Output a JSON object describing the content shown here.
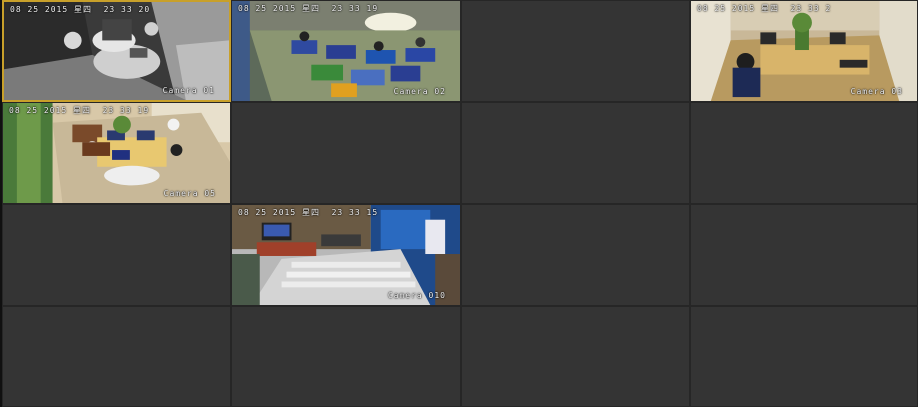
{
  "grid": {
    "columns": 4,
    "rows": 4
  },
  "selected_color": "#c8a02a",
  "cells": [
    {
      "index": 0,
      "has_feed": true,
      "feed": "ir-night-office",
      "timestamp": "08 25 2015 星四  23 33 20",
      "camera": "Camera 01",
      "selected": true
    },
    {
      "index": 1,
      "has_feed": true,
      "feed": "cafe-room-wide",
      "timestamp": "08 25 2015 星四  23 33 19",
      "camera": "Camera 02"
    },
    {
      "index": 2,
      "has_feed": false
    },
    {
      "index": 3,
      "has_feed": true,
      "feed": "tatami-room",
      "timestamp": "08 25 2015 星四  23 33 2",
      "camera": "Camera 03"
    },
    {
      "index": 4,
      "has_feed": true,
      "feed": "desk-group",
      "timestamp": "08 25 2015 星四  23 33 19",
      "camera": "Camera 05"
    },
    {
      "index": 5,
      "has_feed": false
    },
    {
      "index": 6,
      "has_feed": false
    },
    {
      "index": 7,
      "has_feed": false
    },
    {
      "index": 8,
      "has_feed": false
    },
    {
      "index": 9,
      "has_feed": true,
      "feed": "lobby-stairs",
      "timestamp": "08 25 2015 星四  23 33 15",
      "camera": "Camera 010"
    },
    {
      "index": 10,
      "has_feed": false
    },
    {
      "index": 11,
      "has_feed": false
    },
    {
      "index": 12,
      "has_feed": false
    },
    {
      "index": 13,
      "has_feed": false
    },
    {
      "index": 14,
      "has_feed": false
    },
    {
      "index": 15,
      "has_feed": false
    }
  ]
}
